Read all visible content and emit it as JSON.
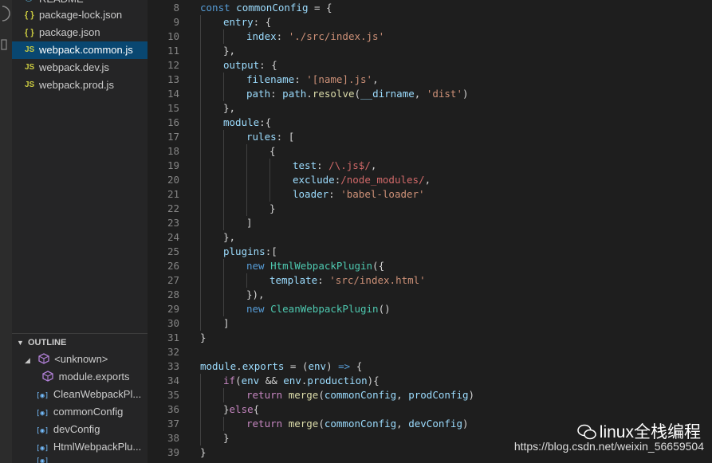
{
  "sidebar": {
    "files": [
      {
        "label": "README",
        "type": "md"
      },
      {
        "label": "package-lock.json",
        "type": "json",
        "icon": "{ }"
      },
      {
        "label": "package.json",
        "type": "json",
        "icon": "{ }"
      },
      {
        "label": "webpack.common.js",
        "type": "js",
        "icon": "JS",
        "active": true
      },
      {
        "label": "webpack.dev.js",
        "type": "js",
        "icon": "JS"
      },
      {
        "label": "webpack.prod.js",
        "type": "js",
        "icon": "JS"
      }
    ],
    "outline": {
      "title": "OUTLINE",
      "items": [
        {
          "label": "<unknown>"
        },
        {
          "label": "module.exports"
        },
        {
          "label": "CleanWebpackPl..."
        },
        {
          "label": "commonConfig"
        },
        {
          "label": "devConfig"
        },
        {
          "label": "HtmlWebpackPlu..."
        }
      ]
    }
  },
  "editor": {
    "line_numbers": [
      "8",
      "9",
      "10",
      "11",
      "12",
      "13",
      "14",
      "15",
      "16",
      "17",
      "18",
      "19",
      "20",
      "21",
      "22",
      "23",
      "24",
      "25",
      "26",
      "27",
      "28",
      "29",
      "30",
      "31",
      "32",
      "33",
      "34",
      "35",
      "36",
      "37",
      "38",
      "39"
    ],
    "tokens": {
      "l8": [
        "const",
        "commonConfig",
        " = {"
      ],
      "l9": [
        "entry",
        ": {"
      ],
      "l10": [
        "index",
        ": ",
        "'./src/index.js'"
      ],
      "l11": [
        "},"
      ],
      "l12": [
        "output",
        ": {"
      ],
      "l13": [
        "filename",
        ": ",
        "'[name].js'",
        ","
      ],
      "l14": [
        "path",
        ": ",
        "path",
        ".",
        "resolve",
        "(",
        "__dirname",
        ", ",
        "'dist'",
        ")"
      ],
      "l15": [
        "},"
      ],
      "l16": [
        "module",
        ":{"
      ],
      "l17": [
        "rules",
        ": ["
      ],
      "l18": [
        "{"
      ],
      "l19": [
        "test",
        ": ",
        "/\\.js$/",
        ","
      ],
      "l20": [
        "exclude",
        ":",
        "/node_modules/",
        ","
      ],
      "l21": [
        "loader",
        ": ",
        "'babel-loader'"
      ],
      "l22": [
        "}"
      ],
      "l23": [
        "]"
      ],
      "l24": [
        "},"
      ],
      "l25": [
        "plugins",
        ":["
      ],
      "l26": [
        "new",
        " ",
        "HtmlWebpackPlugin",
        "({"
      ],
      "l27": [
        "template",
        ": ",
        "'src/index.html'"
      ],
      "l28": [
        "}),"
      ],
      "l29": [
        "new",
        " ",
        "CleanWebpackPlugin",
        "()"
      ],
      "l30": [
        "]"
      ],
      "l31": [
        "}"
      ],
      "l32": [
        ""
      ],
      "l33": [
        "module",
        ".",
        "exports",
        " = (",
        "env",
        ") ",
        "=>",
        " {"
      ],
      "l34": [
        "if",
        "(",
        "env",
        " && ",
        "env",
        ".",
        "production",
        "){"
      ],
      "l35": [
        "return",
        " ",
        "merge",
        "(",
        "commonConfig",
        ", ",
        "prodConfig",
        ")"
      ],
      "l36": [
        "}",
        "else",
        "{"
      ],
      "l37": [
        "return",
        " ",
        "merge",
        "(",
        "commonConfig",
        ", ",
        "devConfig",
        ")"
      ],
      "l38": [
        "}"
      ],
      "l39": [
        "}"
      ]
    }
  },
  "watermark": {
    "title": "linux全栈编程",
    "url": "https://blog.csdn.net/weixin_56659504"
  },
  "colors": {
    "background": "#1e1e1e",
    "sidebar": "#252526",
    "active_file": "#094771",
    "keyword": "#569cd6",
    "property": "#9cdcfe",
    "string": "#ce9178",
    "function": "#dcdcaa",
    "class": "#4ec9b0",
    "regex": "#d16969"
  }
}
